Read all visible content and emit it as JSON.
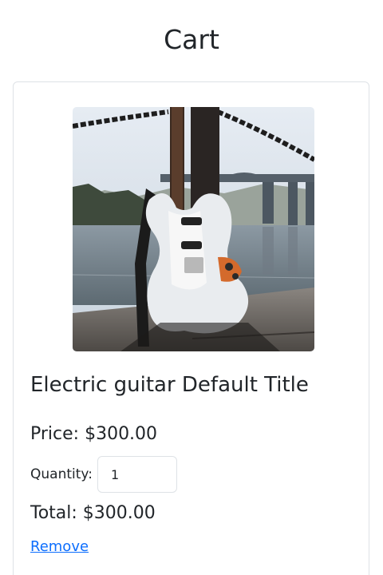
{
  "page": {
    "title": "Cart"
  },
  "cart_item": {
    "image_alt": "Electric guitar",
    "title": "Electric guitar Default Title",
    "price": "Price: $300.00",
    "quantity_label": "Quantity:",
    "quantity_value": "1",
    "total": "Total: $300.00",
    "remove_label": "Remove"
  },
  "colors": {
    "link": "#0d6efd",
    "border": "#dee2e6",
    "text": "#212529"
  }
}
